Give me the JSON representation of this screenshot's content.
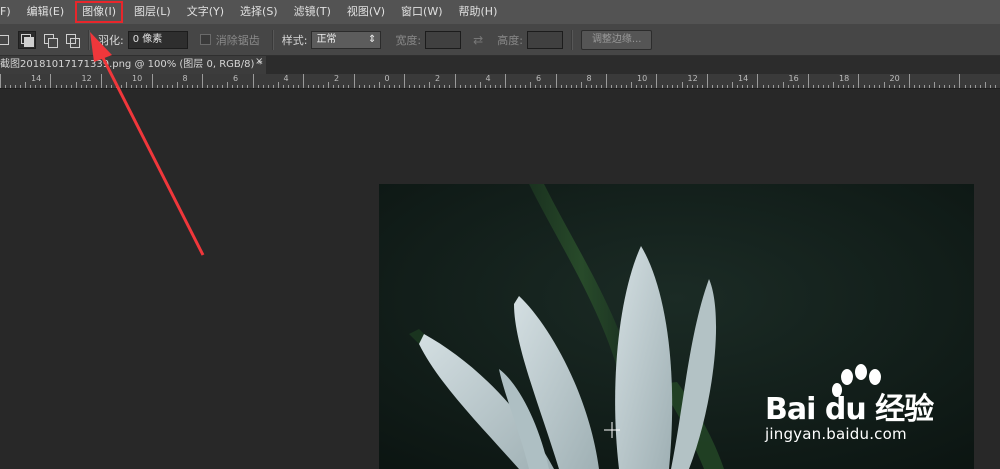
{
  "menubar": {
    "items": [
      "F)",
      "编辑(E)",
      "图像(I)",
      "图层(L)",
      "文字(Y)",
      "选择(S)",
      "滤镜(T)",
      "视图(V)",
      "窗口(W)",
      "帮助(H)"
    ]
  },
  "options": {
    "feather_label": "羽化:",
    "feather_value": "0 像素",
    "antialias_label": "消除锯齿",
    "style_label": "样式:",
    "style_value": "正常",
    "width_label": "宽度:",
    "height_label": "高度:",
    "refine_button": "调整边缘..."
  },
  "document": {
    "tab_title": "截图20181017171339.png @ 100% (图层 0, RGB/8) *",
    "close": "×"
  },
  "ruler": {
    "labels": [
      "14",
      "12",
      "10",
      "8",
      "6",
      "4",
      "2",
      "0",
      "2",
      "4",
      "6",
      "8",
      "10",
      "12",
      "14",
      "16",
      "18",
      "20"
    ]
  },
  "watermark": {
    "text": "jingyan.baidu.com",
    "logo": "Bai du 经验"
  },
  "colors": {
    "highlight": "#e8262b",
    "arrow": "#f0373b"
  }
}
